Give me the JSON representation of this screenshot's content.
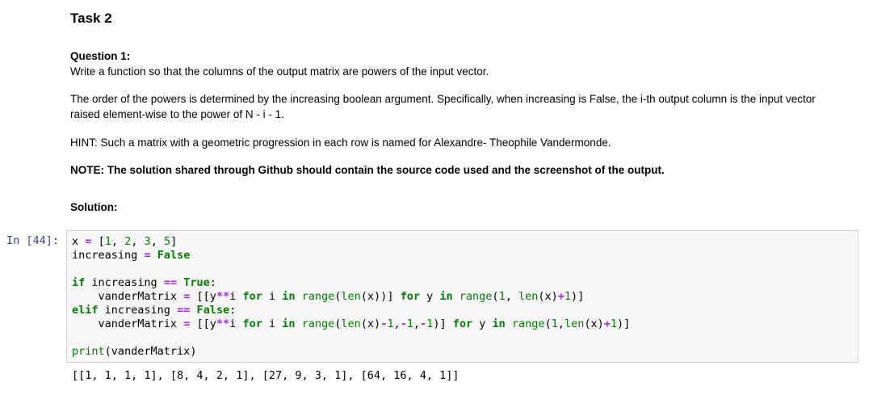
{
  "markdown": {
    "task_heading": "Task 2",
    "question_label": "Question 1:",
    "question_text": "Write a function so that the columns of the output matrix are powers of the input vector.",
    "order_text_line1": "The order of the powers is determined by the increasing boolean argument. Specifically, when increasing is False, the i-th output column is the input vector",
    "order_text_line2": "raised element-wise to the power of N - i - 1.",
    "hint_text": "HINT: Such a matrix with a geometric progression in each row is named for Alexandre- Theophile Vandermonde.",
    "note_text": "NOTE: The solution shared through Github should contain the source code used and the screenshot of the output.",
    "solution_label": "Solution:"
  },
  "cell": {
    "prompt": "In [44]:",
    "output": "[[1, 1, 1, 1], [8, 4, 2, 1], [27, 9, 3, 1], [64, 16, 4, 1]]"
  },
  "code_tokens": {
    "x_var": "x",
    "eq": "=",
    "list_open": "[",
    "n1": "1",
    "n2": "2",
    "n3": "3",
    "n5": "5",
    "comma": ",",
    "list_close": "]",
    "increasing": "increasing",
    "False": "False",
    "True": "True",
    "if": "if",
    "elif": "elif",
    "eqeq": "==",
    "colon": ":",
    "vanderMatrix": "vanderMatrix",
    "pow": "**",
    "for": "for",
    "in": "in",
    "range": "range",
    "len": "len",
    "print": "print",
    "plus": "+",
    "minus": "-"
  }
}
